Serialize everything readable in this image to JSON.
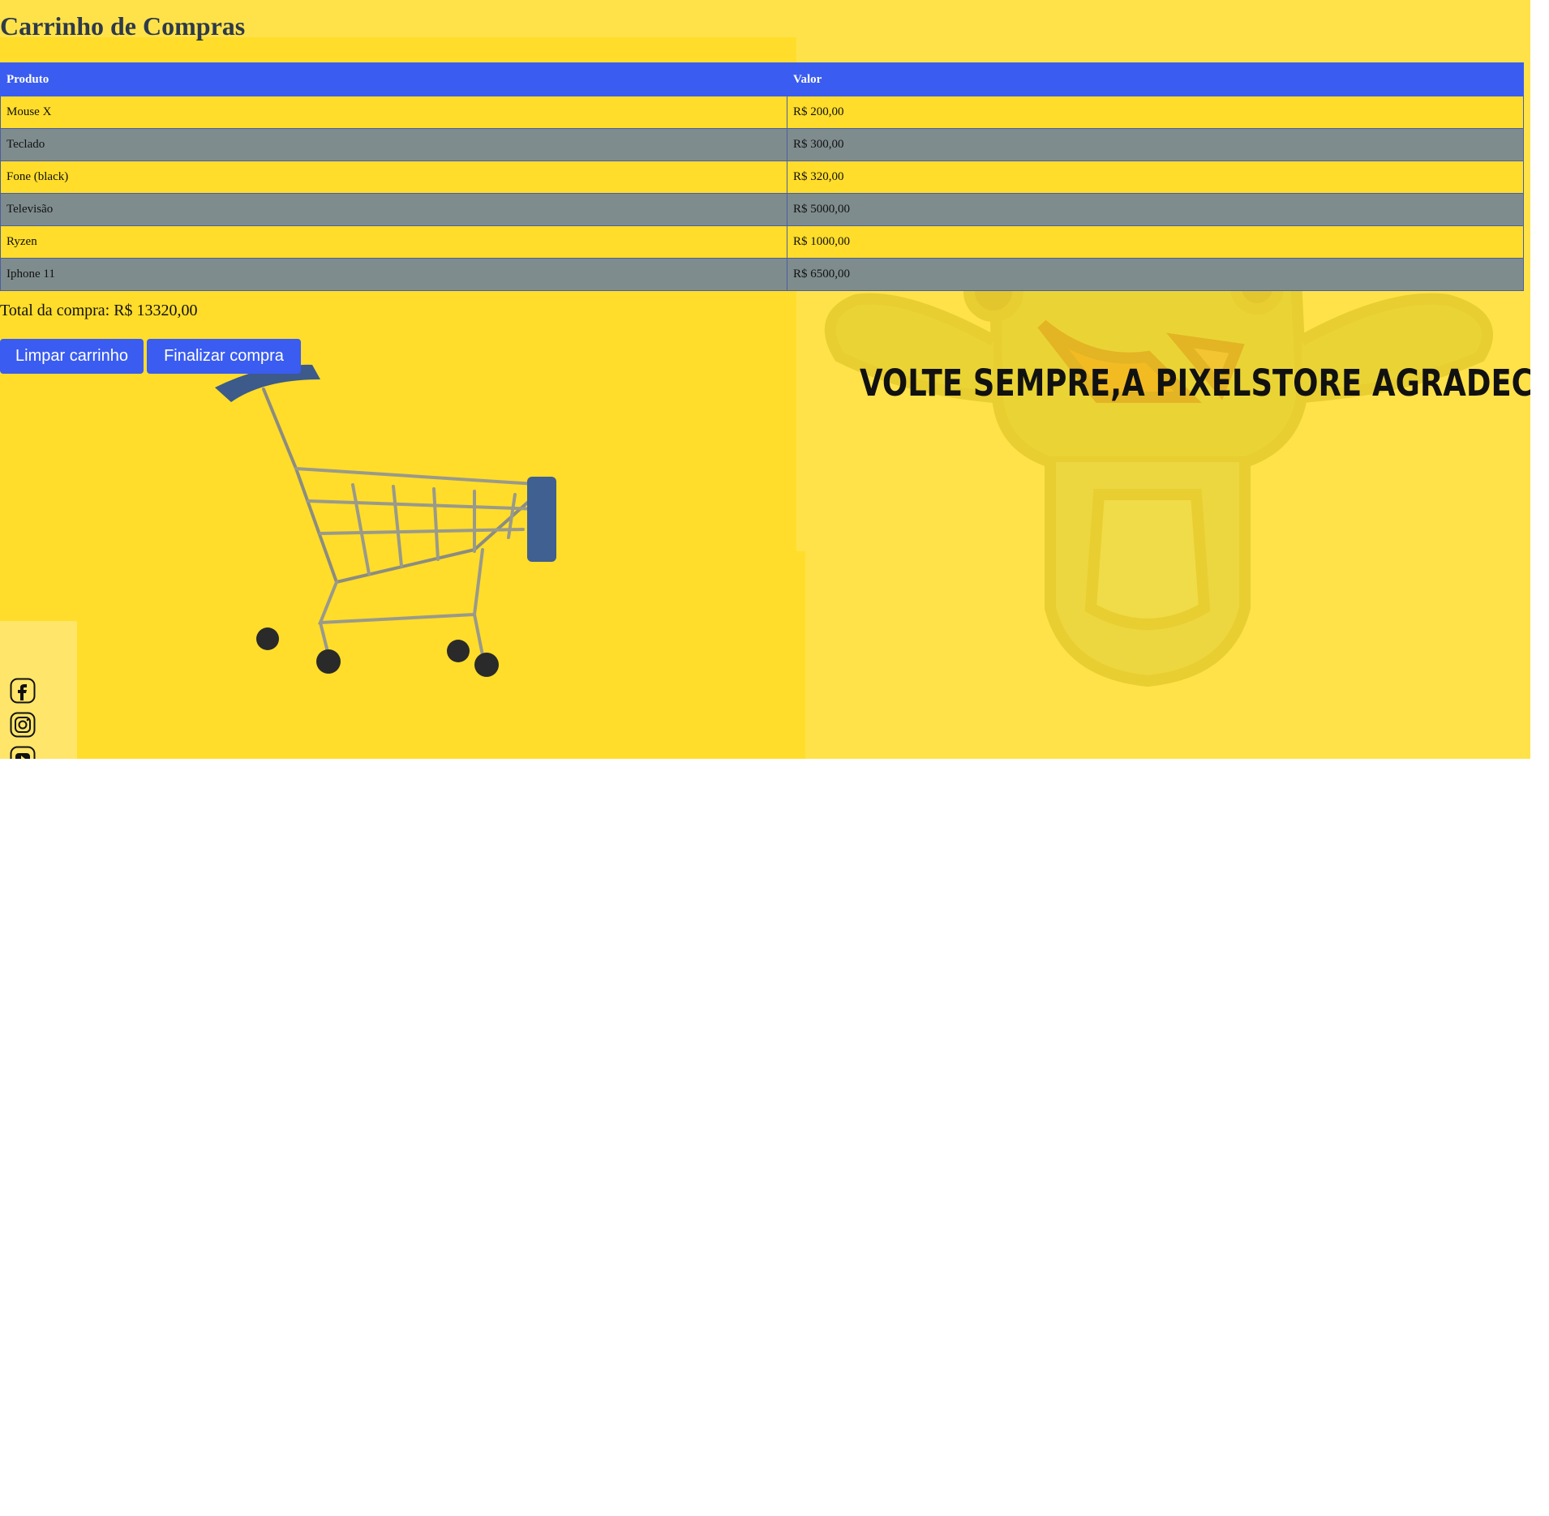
{
  "page": {
    "title": "Carrinho de Compras",
    "total_label": "Total da compra: R$ 13320,00",
    "thanks_message": "VOLTE SEMPRE,A PIXELSTORE AGRADECE!"
  },
  "table": {
    "headers": {
      "product": "Produto",
      "value": "Valor"
    },
    "rows": [
      {
        "product": "Mouse X",
        "value": "R$ 200,00"
      },
      {
        "product": "Teclado",
        "value": "R$ 300,00"
      },
      {
        "product": "Fone (black)",
        "value": "R$ 320,00"
      },
      {
        "product": "Televisão",
        "value": "R$ 5000,00"
      },
      {
        "product": "Ryzen",
        "value": "R$ 1000,00"
      },
      {
        "product": "Iphone 11",
        "value": "R$ 6500,00"
      }
    ]
  },
  "buttons": {
    "clear_label": "Limpar carrinho",
    "finish_label": "Finalizar compra"
  },
  "social": [
    "facebook-icon",
    "instagram-icon",
    "youtube-icon"
  ],
  "colors": {
    "accent": "#3a5cf0",
    "background": "#ffe24a",
    "row_alt": "#7f8c8d"
  }
}
